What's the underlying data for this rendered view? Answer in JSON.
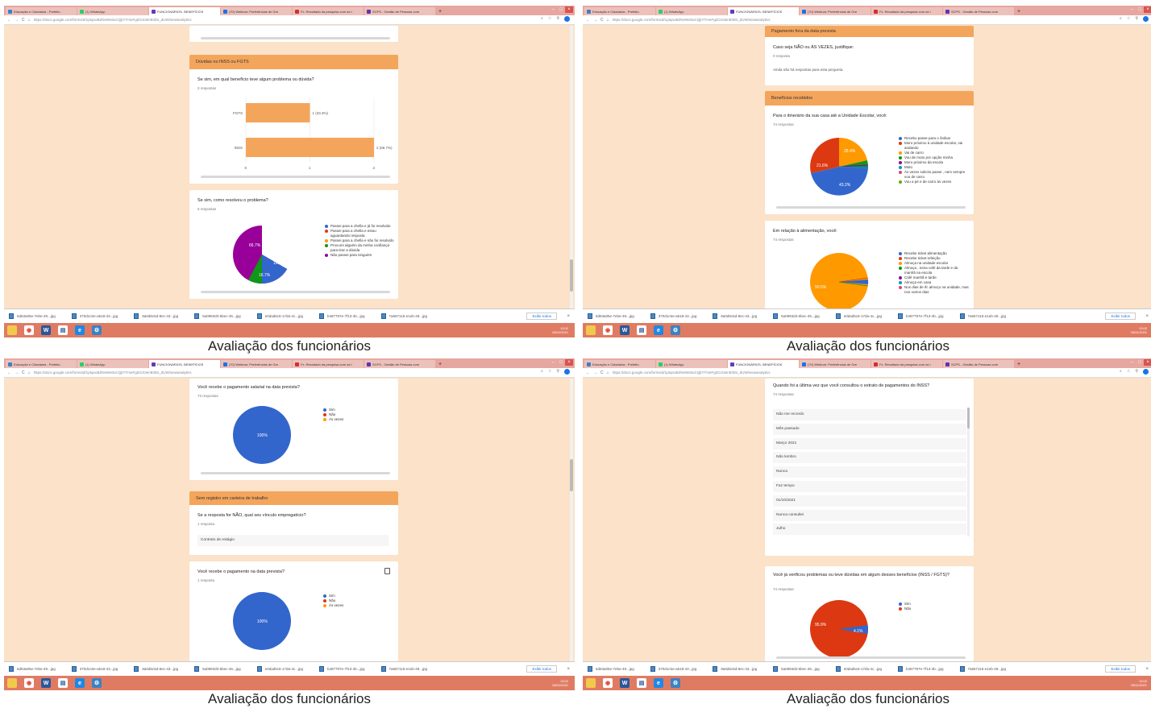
{
  "caption": "Avaliação dos funcionários",
  "browser": {
    "tabs": [
      {
        "label": "Educação e Cidadania - Prefeitu",
        "color": "#3b82c4"
      },
      {
        "label": "(1) WhatsApp",
        "color": "#25d366"
      },
      {
        "label": "FUNCIONÁRIOS- BENEFÍCIOS",
        "color": "#673ab7"
      },
      {
        "label": "(70) Webinar: Preferências de Gre",
        "color": "#1a73e8"
      },
      {
        "label": "Fx. Resultado da pesquisa com os t",
        "color": "#d32f2f"
      },
      {
        "label": "SCPS - Gestão de Pessoas com",
        "color": "#5e35b1"
      }
    ],
    "url": "https://docs.google.com/forms/d/1ptqnoBZNeWs0uCQjtYTmeFgtZ1X3en83Ds_dUW/viewanalytics",
    "new_tab": "+",
    "minimize": "–",
    "maximize": "□",
    "close": "×",
    "back": "←",
    "forward": "→",
    "reload": "C",
    "home": "⌂",
    "lock": "🔒"
  },
  "downloads": {
    "items": [
      "5d63a05e-7ebe-49...jpg",
      "370d1c5e-a518-43...jpg",
      "8a0d6c5d-8ec-43...jpg",
      "5a0893d3-6bec-45...jpg",
      "e0dad5c6-17da-4c...jpg",
      "b487797e-7f13-4b...jpg",
      "7a667115-e1eb-49...jpg"
    ],
    "show_all": "Exibir todos",
    "close": "×"
  },
  "taskbar": {
    "time": "13:02",
    "date": "08/11/2021",
    "lang": "POR PTB2"
  },
  "panel1": {
    "section": "Dúvidas no INSS ou FGTS",
    "q1": {
      "title": "Se sim, em qual benefício teve algum problema ou dúvida?",
      "sub": "3 respostas"
    },
    "q2": {
      "title": "Se sim, como resolveu o problema?",
      "sub": "6 respostas"
    },
    "pie_labels": [
      "66.7%",
      "16.7%",
      "16.7%"
    ],
    "legend": [
      "Passei para a chefia e já foi resolvido",
      "Passei para a chefia e estou aguardando resposta",
      "Passei para a chefia e não foi resolvido",
      "Procurei alguém da minha confiança para tirar a dúvida",
      "Não passei para ninguém"
    ]
  },
  "panel2": {
    "section1": "Pagamento fora da data prevista",
    "q1": {
      "title": "Caso seja NÃO ou ÀS VEZES, justifique:",
      "sub": "0 resposta",
      "empty": "Ainda não há respostas para esta pergunta."
    },
    "section2": "Benefícios recebidos",
    "q2": {
      "title": "Para o itinerário da sua casa até a Unidade Escolar, você:",
      "sub": "74 respostas"
    },
    "pie1_labels": [
      "28.4%",
      "21.6%",
      "43.2%"
    ],
    "legend1": [
      "Recebo passe para o ônibus",
      "Moro próximo à unidade escolar, vai andando",
      "Vai de carro",
      "Vou de moto por opção minha",
      "Moro próximo da escola",
      "Moto",
      "Às vezes solicito passe , nem sempre vou de carro",
      "Vou a pé e de carro às vezes"
    ],
    "q3": {
      "title": "Em relação à alimentação, você:",
      "sub": "74 respostas"
    },
    "pie2_labels": [
      "90.5%"
    ],
    "legend2": [
      "Recebe ticket alimentação",
      "Recebe ticket refeição",
      "Almoça na unidade escolar",
      "Almoça , toma café da tarde e da manhã na escola",
      "Café manhã e tarde",
      "Almoça em casa",
      "Nos dias de ifc almoço na unidade, mas nos outros dias"
    ]
  },
  "panel3": {
    "q1": {
      "title": "Você recebe o pagamento salarial na data prevista?",
      "sub": "73 respostas"
    },
    "pie1_label": "100%",
    "legend": [
      "Sim",
      "Não",
      "Às vezes"
    ],
    "section": "Sem registro em carteira de trabalho",
    "q2": {
      "title": "Se a resposta for NÃO, qual seu vínculo empregatício?",
      "sub": "1 resposta",
      "answer": "Contrato de estágio"
    },
    "q3": {
      "title": "Você recebe o pagamento na data prevista?",
      "sub": "1 resposta"
    },
    "pie2_label": "100%"
  },
  "panel4": {
    "q1": {
      "title": "Quando foi a última vez que você consultou o extrato de pagamentos do INSS?",
      "sub": "74 respostas"
    },
    "list": [
      "Não me recordo",
      "Mês passado",
      "Março 2021",
      "Não lembro",
      "Nunca",
      "Faz tempo",
      "01/10/2021",
      "Nunca consultei",
      "Julho"
    ],
    "q2": {
      "title": "Você já verificou problemas ou teve dúvidas em algum desses benefícios (INSS / FGTS)?",
      "sub": "74 respostas"
    },
    "pie_labels": [
      "95.9%",
      "4.1%"
    ],
    "legend": [
      "Sim",
      "Não"
    ]
  },
  "chart_data": [
    {
      "type": "bar",
      "title": "Se sim, em qual benefício teve algum problema ou dúvida?",
      "categories": [
        "FGTS",
        "INSS"
      ],
      "values": [
        1,
        2
      ],
      "data_labels": [
        "1 (33.3%)",
        "2 (66.7%)"
      ],
      "xlim": [
        0,
        2
      ],
      "xticks": [
        "0",
        "1",
        "2"
      ],
      "orientation": "horizontal",
      "color": "#f4a55c"
    }
  ]
}
